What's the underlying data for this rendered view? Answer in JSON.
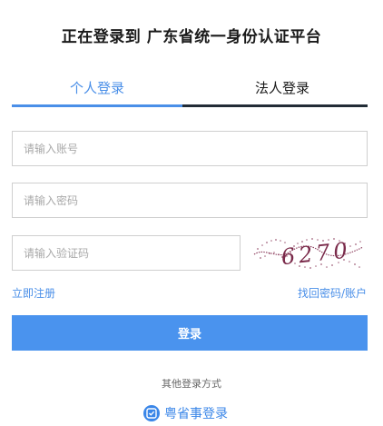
{
  "header": {
    "title": "正在登录到 广东省统一身份认证平台"
  },
  "tabs": [
    {
      "label": "个人登录",
      "active": true
    },
    {
      "label": "法人登录",
      "active": false
    }
  ],
  "form": {
    "account_placeholder": "请输入账号",
    "password_placeholder": "请输入密码",
    "captcha_placeholder": "请输入验证码",
    "captcha_text": "6270"
  },
  "links": {
    "register": "立即注册",
    "forgot": "找回密码/账户"
  },
  "login_button": "登录",
  "other_login": {
    "title": "其他登录方式",
    "yss_label": "粤省事登录",
    "yss_icon": "yss-app-icon"
  },
  "colors": {
    "accent": "#4a8fe8",
    "button": "#4a93ee",
    "tab_inactive_bar": "#222c36",
    "captcha_ink": "#7a2a4a"
  }
}
